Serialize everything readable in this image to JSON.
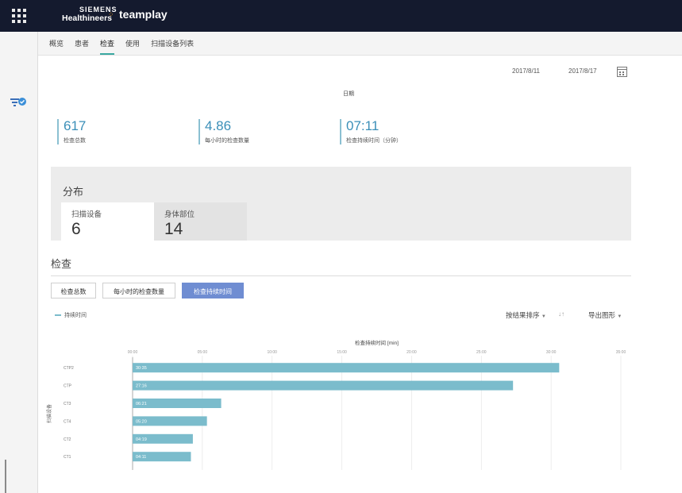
{
  "brand": {
    "company_line1": "SIEMENS",
    "company_line2": "Healthineers",
    "app_name": "teamplay"
  },
  "nav": {
    "tabs": [
      {
        "label": "概览",
        "active": false
      },
      {
        "label": "患者",
        "active": false
      },
      {
        "label": "检查",
        "active": true
      },
      {
        "label": "使用",
        "active": false
      },
      {
        "label": "扫描设备列表",
        "active": false
      }
    ]
  },
  "dates": {
    "start": "2017/8/11",
    "end": "2017/8/17",
    "caption": "日期"
  },
  "kpis": [
    {
      "value": "617",
      "label": "检查总数"
    },
    {
      "value": "4.86",
      "label": "每小时的检查数量"
    },
    {
      "value": "07:11",
      "label": "检查持续时间（分钟）"
    }
  ],
  "distribution": {
    "title": "分布",
    "cards": [
      {
        "label": "扫描设备",
        "value": "6",
        "active": true
      },
      {
        "label": "身体部位",
        "value": "14",
        "active": false
      }
    ]
  },
  "exam": {
    "title": "检查",
    "buttons": [
      {
        "label": "检查总数",
        "active": false
      },
      {
        "label": "每小时的检查数量",
        "active": false
      },
      {
        "label": "检查持续时间",
        "active": true
      }
    ],
    "legend_label": "持续时间",
    "sort_label": "按结果排序",
    "sort_icon": "↓↑",
    "export_label": "导出图形"
  },
  "colors": {
    "accent": "#3b8fb8",
    "bar": "#7bbccc",
    "active_button": "#6f8dd2",
    "topbar": "#141a2e",
    "tab_underline": "#3aa9a1"
  },
  "chart_data": {
    "type": "bar",
    "orientation": "horizontal",
    "title": "检查持续时间 [min]",
    "ylabel": "扫描设备",
    "x_tick_labels": [
      "00:00",
      "05:00",
      "10:00",
      "15:00",
      "20:00",
      "25:00",
      "30:00",
      "35:00"
    ],
    "xlim": [
      0,
      35
    ],
    "categories": [
      "CTP2",
      "CTP",
      "CT3",
      "CT4",
      "CT2",
      "CT1"
    ],
    "values_min": [
      30.58,
      27.27,
      6.35,
      5.33,
      4.32,
      4.18
    ],
    "value_labels": [
      "30:35",
      "27:16",
      "06:21",
      "05:20",
      "04:19",
      "04:11"
    ],
    "series": [
      {
        "name": "持续时间"
      }
    ],
    "grid": true
  }
}
